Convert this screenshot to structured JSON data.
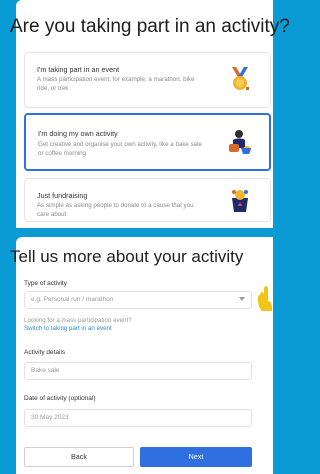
{
  "sections": {
    "activity_choice": {
      "title": "Are you taking part in an activity?",
      "options": [
        {
          "title": "I'm taking part in an event",
          "desc": "A mass participation event, for example, a marathon, bike ride, or trek",
          "illustration": "medal-icon",
          "selected": false
        },
        {
          "title": "I'm doing my own activity",
          "desc": "Get creative and organise your own activity, like a bake sale or coffee morning",
          "illustration": "person-activity-icon",
          "selected": true
        },
        {
          "title": "Just fundraising",
          "desc": "As simple as asking people to donate to a cause that you care about",
          "illustration": "fundraising-icon",
          "selected": false
        }
      ]
    },
    "details": {
      "title": "Tell us more about your activity",
      "type_label": "Type of activity",
      "type_placeholder": "e.g. Personal run / marathon",
      "looking_for": "Looking for a mass participation event?",
      "switch_link": "Switch to taking part in an event",
      "details_label": "Activity details",
      "details_value": "Bake sale",
      "date_label": "Date of activity (optional)",
      "date_value": "30 May 2023"
    }
  },
  "buttons": {
    "back": "Back",
    "next": "Next"
  },
  "colors": {
    "background": "#0a9bd4",
    "accent": "#2f6fe0"
  }
}
